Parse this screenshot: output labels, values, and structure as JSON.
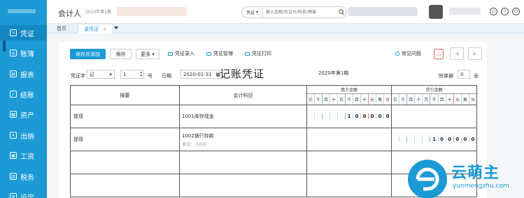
{
  "app": {
    "title": "会计人",
    "period": "2020年第1期"
  },
  "sidebar": {
    "items": [
      {
        "label": "凭证"
      },
      {
        "label": "账簿"
      },
      {
        "label": "报表"
      },
      {
        "label": "结账"
      },
      {
        "label": "资产"
      },
      {
        "label": "出纳"
      },
      {
        "label": "工资"
      },
      {
        "label": "税务"
      },
      {
        "label": "设定"
      }
    ]
  },
  "search": {
    "category": "凭证",
    "placeholder": "输入金额/凭证号/科目/摘要"
  },
  "tabs": [
    {
      "label": "首页"
    },
    {
      "label": "录凭证"
    }
  ],
  "toolbar": {
    "save_add": "保存并添加",
    "save": "保存",
    "more": "更多",
    "voucher_entry": "凭证录入",
    "voucher_manage": "凭证管理",
    "voucher_print": "凭证打印",
    "faq": "常见问题"
  },
  "header": {
    "voucher_word_label": "凭证字",
    "voucher_word_value": "记",
    "number_value": "1",
    "number_unit": "号",
    "date_label": "日期",
    "date_value": "2020-01-31",
    "doc_title": "记账凭证",
    "doc_period": "2020年第1期",
    "attachments_label": "附单据",
    "attachments_value": "0",
    "attachments_unit": "张"
  },
  "table": {
    "col_summary": "摘要",
    "col_account": "会计科目",
    "col_debit": "借方金额",
    "col_credit": "贷方金额",
    "digit_units": [
      "亿",
      "千",
      "百",
      "十",
      "万",
      "千",
      "百",
      "十",
      "元",
      "角",
      "分"
    ],
    "rows": [
      {
        "summary": "提现",
        "account": "1001库存现金",
        "balance": "",
        "debit": "100000",
        "credit": ""
      },
      {
        "summary": "提现",
        "account": "1002银行存款",
        "balance": "显余：-1000",
        "debit": "",
        "credit": "100000"
      }
    ]
  },
  "watermark": {
    "brand": "云萌主",
    "site": "yunmengzhu.com"
  }
}
